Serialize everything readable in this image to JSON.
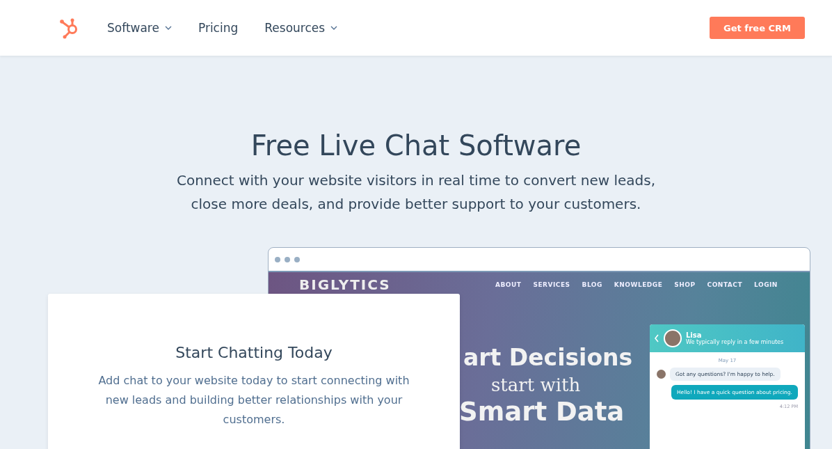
{
  "nav": {
    "items": [
      {
        "label": "Software",
        "dropdown": true
      },
      {
        "label": "Pricing",
        "dropdown": false
      },
      {
        "label": "Resources",
        "dropdown": true
      }
    ],
    "cta": "Get free CRM"
  },
  "hero": {
    "title": "Free Live Chat Software",
    "subtitle": "Connect with your website visitors in real time to convert new leads, close more deals, and provide better support to your customers."
  },
  "mock_site": {
    "logo": "BIGLYTICS",
    "links": [
      "ABOUT",
      "SERVICES",
      "BLOG",
      "KNOWLEDGE",
      "SHOP",
      "CONTACT",
      "LOGIN"
    ],
    "headline_1": "art Decisions",
    "headline_2": "start with",
    "headline_3": "Smart Data"
  },
  "chat": {
    "agent": "Lisa",
    "status": "We typically reply in a few minutes",
    "date": "May 17",
    "messages": [
      {
        "kind": "incoming",
        "text": "Got any questions? I'm happy to help."
      },
      {
        "kind": "outgoing",
        "text": "Hello! I have a quick question about pricing."
      }
    ],
    "time": "4:12 PM"
  },
  "card": {
    "title": "Start Chatting Today",
    "body": "Add chat to your website today to start connecting with new leads and building better relationships with your customers."
  }
}
